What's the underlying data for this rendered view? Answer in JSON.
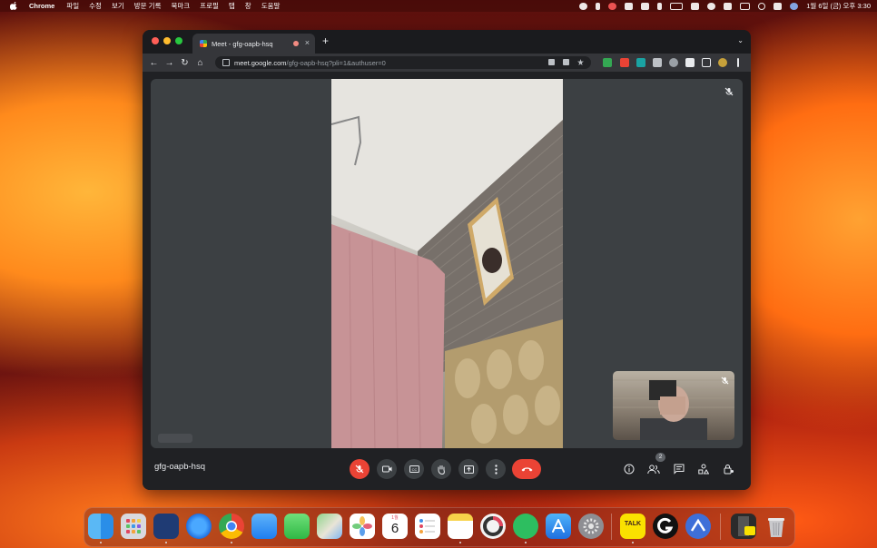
{
  "menubar": {
    "app_name": "Chrome",
    "items": [
      "파일",
      "수정",
      "보기",
      "방문 기록",
      "북마크",
      "프로필",
      "탭",
      "창",
      "도움말"
    ],
    "clock": "1월 6일 (금) 오후 3:30"
  },
  "browser": {
    "tab_title": "Meet - gfg-oapb-hsq",
    "tab_close": "×",
    "new_tab": "+",
    "url_host": "meet.google.com",
    "url_path": "/gfg-oapb-hsq?pli=1&authuser=0"
  },
  "meet": {
    "meeting_code": "gfg-oapb-hsq",
    "participants_count": "2",
    "controls": [
      "mic-off",
      "camera",
      "captions",
      "raise-hand",
      "present",
      "more-options",
      "leave-call"
    ],
    "right_controls": [
      "meeting-details",
      "people",
      "chat",
      "activities",
      "host-controls"
    ]
  },
  "dock": {
    "apps": [
      "finder",
      "launchpad",
      "bird-app",
      "safari",
      "chrome",
      "mail",
      "messages",
      "maps",
      "photos",
      "calendar",
      "reminders",
      "notes",
      "activity-monitor",
      "evernote",
      "app-store",
      "system-settings",
      "kakaotalk",
      "g-app",
      "nordvpn",
      "downloads",
      "trash"
    ],
    "calendar_day": "6",
    "calendar_month": "1월",
    "kakao_label": "TALK"
  }
}
